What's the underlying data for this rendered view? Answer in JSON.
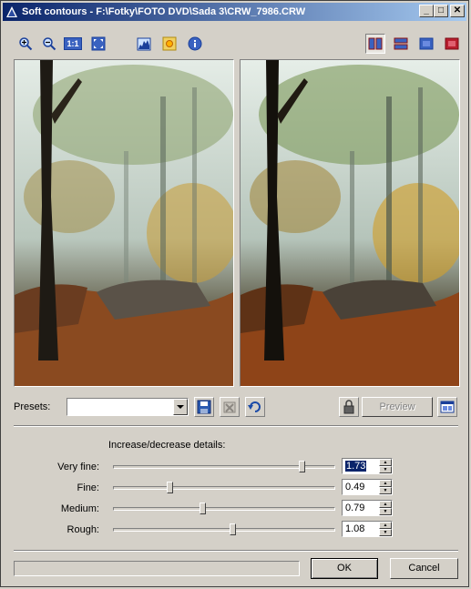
{
  "window": {
    "title": "Soft contours - F:\\Fotky\\FOTO DVD\\Sada 3\\CRW_7986.CRW",
    "minimize_symbol": "_",
    "maximize_symbol": "□",
    "close_symbol": "✕"
  },
  "toolbar": {
    "zoom_in_icon": "zoom-in-icon",
    "zoom_out_icon": "zoom-out-icon",
    "actual_size_label": "1:1",
    "fit_icon": "fit-to-window-icon",
    "histogram_icon": "histogram-icon",
    "highlight_icon": "sun-icon",
    "info_icon": "info-icon",
    "view_modes": [
      "split-vertical-icon",
      "split-horizontal-icon",
      "single-original-icon",
      "single-result-icon"
    ]
  },
  "presets": {
    "label": "Presets:",
    "value": "",
    "preview_label": "Preview"
  },
  "details": {
    "heading": "Increase/decrease details:",
    "sliders": [
      {
        "label": "Very fine:",
        "value": "1.73",
        "level": 0.86
      },
      {
        "label": "Fine:",
        "value": "0.49",
        "level": 0.25
      },
      {
        "label": "Medium:",
        "value": "0.79",
        "level": 0.4
      },
      {
        "label": "Rough:",
        "value": "1.08",
        "level": 0.54
      }
    ]
  },
  "footer": {
    "progress": 0,
    "ok_label": "OK",
    "cancel_label": "Cancel"
  },
  "colors": {
    "title_start": "#0a246a",
    "title_end": "#a6caf0",
    "face": "#d4d0c8"
  }
}
